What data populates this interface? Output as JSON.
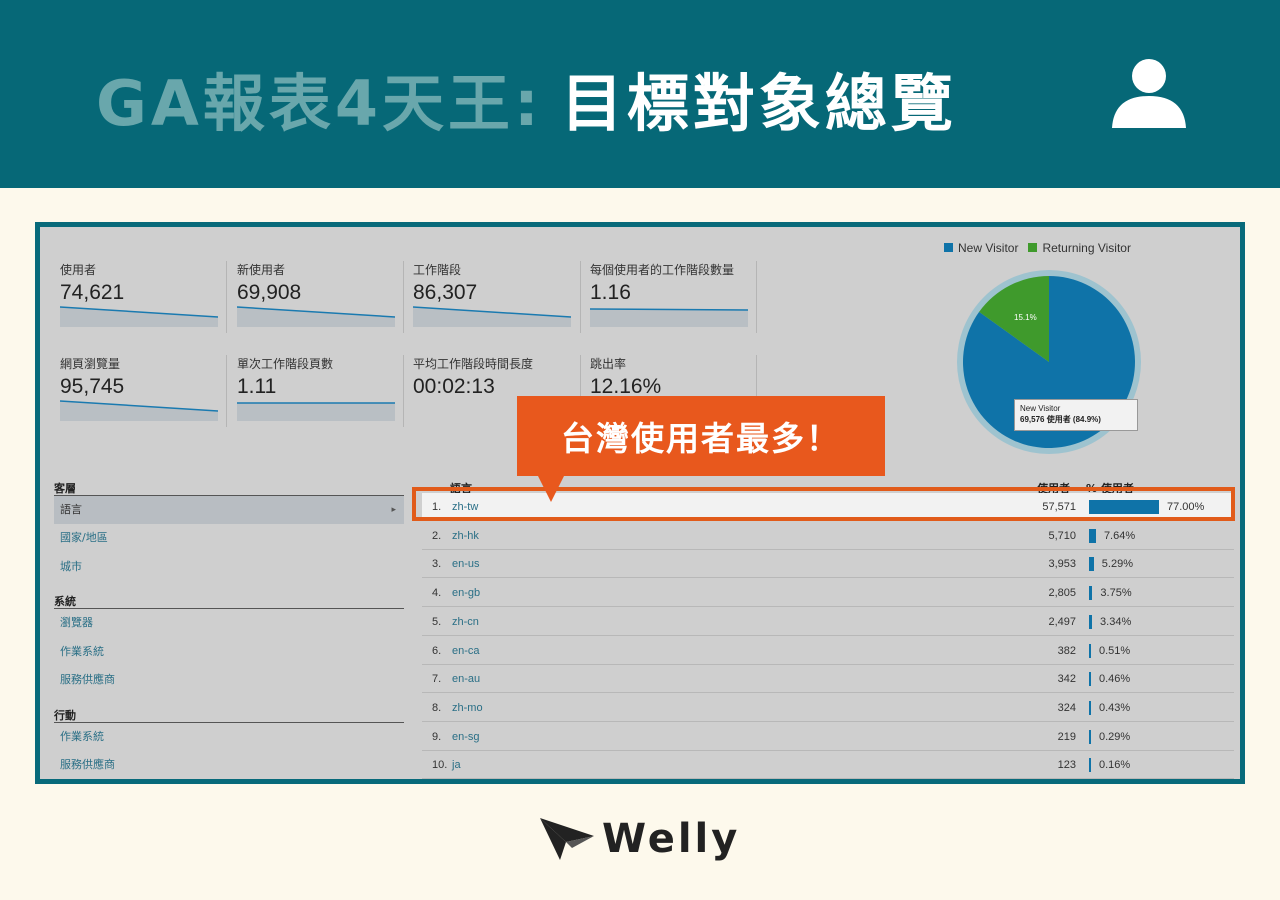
{
  "banner": {
    "title_prefix": "GA報表4天王:",
    "title_main": "目標對象總覽",
    "bg_color": "#066877"
  },
  "metrics": [
    {
      "label": "使用者",
      "value": "74,621"
    },
    {
      "label": "新使用者",
      "value": "69,908"
    },
    {
      "label": "工作階段",
      "value": "86,307"
    },
    {
      "label": "每個使用者的工作階段數量",
      "value": "1.16"
    },
    {
      "label": "網頁瀏覽量",
      "value": "95,745"
    },
    {
      "label": "單次工作階段頁數",
      "value": "1.11"
    },
    {
      "label": "平均工作階段時間長度",
      "value": "00:02:13"
    },
    {
      "label": "跳出率",
      "value": "12.16%"
    }
  ],
  "legend": {
    "new_visitor": "New Visitor",
    "returning_visitor": "Returning Visitor",
    "new_color": "#0f73a8",
    "returning_color": "#3f9a2c"
  },
  "pie": {
    "returning_pct_label": "15.1%",
    "returning_fraction": 0.151,
    "tooltip_title": "New Visitor",
    "tooltip_value": "69,576 使用者 (84.9%)"
  },
  "nav": {
    "section1": "客層",
    "s1_items": [
      "語言",
      "國家/地區",
      "城市"
    ],
    "section2": "系統",
    "s2_items": [
      "瀏覽器",
      "作業系統",
      "服務供應商"
    ],
    "section3": "行動",
    "s3_items": [
      "作業系統",
      "服務供應商"
    ]
  },
  "table": {
    "col_lang": "語言",
    "col_users": "使用者",
    "col_pct": "% 使用者",
    "rows": [
      {
        "idx": "1.",
        "lang": "zh-tw",
        "users": "57,571",
        "pct": "77.00%",
        "frac": 0.77
      },
      {
        "idx": "2.",
        "lang": "zh-hk",
        "users": "5,710",
        "pct": "7.64%",
        "frac": 0.0764
      },
      {
        "idx": "3.",
        "lang": "en-us",
        "users": "3,953",
        "pct": "5.29%",
        "frac": 0.0529
      },
      {
        "idx": "4.",
        "lang": "en-gb",
        "users": "2,805",
        "pct": "3.75%",
        "frac": 0.0375
      },
      {
        "idx": "5.",
        "lang": "zh-cn",
        "users": "2,497",
        "pct": "3.34%",
        "frac": 0.0334
      },
      {
        "idx": "6.",
        "lang": "en-ca",
        "users": "382",
        "pct": "0.51%",
        "frac": 0.0051
      },
      {
        "idx": "7.",
        "lang": "en-au",
        "users": "342",
        "pct": "0.46%",
        "frac": 0.0046
      },
      {
        "idx": "8.",
        "lang": "zh-mo",
        "users": "324",
        "pct": "0.43%",
        "frac": 0.0043
      },
      {
        "idx": "9.",
        "lang": "en-sg",
        "users": "219",
        "pct": "0.29%",
        "frac": 0.0029
      },
      {
        "idx": "10.",
        "lang": "ja",
        "users": "123",
        "pct": "0.16%",
        "frac": 0.0016
      }
    ]
  },
  "callout": {
    "text": "台灣使用者最多！",
    "color": "#e8581d"
  },
  "logo": {
    "text": "Welly"
  }
}
